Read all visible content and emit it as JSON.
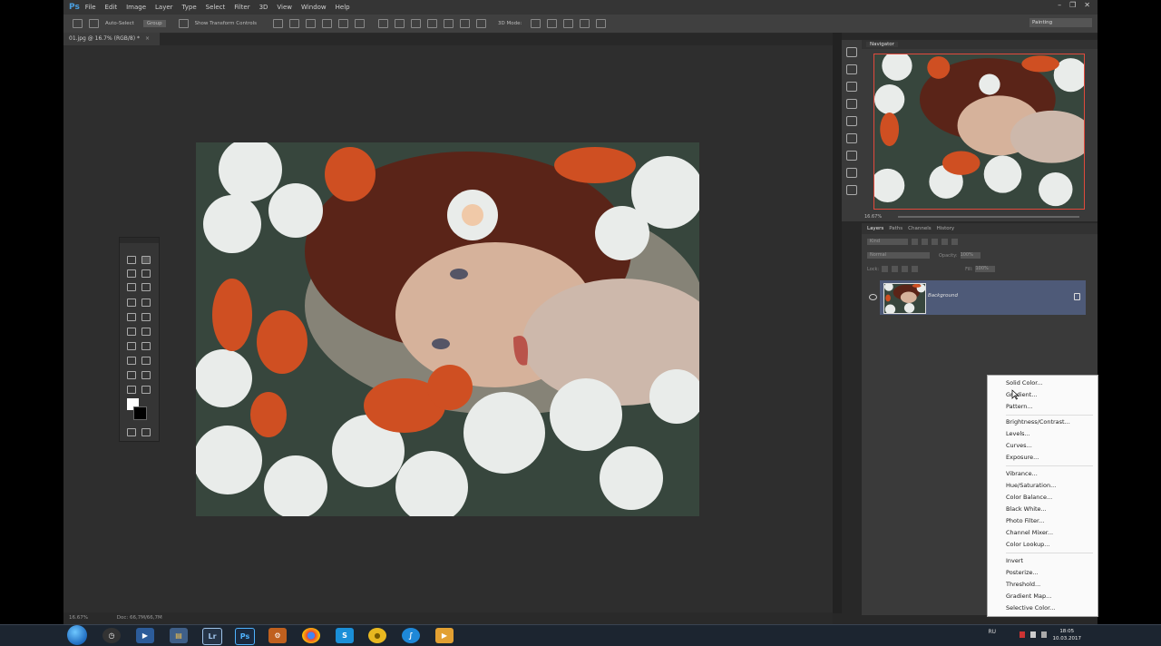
{
  "app": {
    "logo": "Ps",
    "window_controls": [
      "–",
      "❐",
      "✕"
    ]
  },
  "menubar": {
    "items": [
      "File",
      "Edit",
      "Image",
      "Layer",
      "Type",
      "Select",
      "Filter",
      "3D",
      "View",
      "Window",
      "Help"
    ]
  },
  "options": {
    "auto_select": "Auto-Select",
    "group": "Group",
    "show_transform": "Show Transform Controls",
    "mode_3d": "3D Mode:",
    "workspace": "Painting"
  },
  "document": {
    "tab_title": "01.jpg @ 16.7% (RGB/8) *",
    "close": "×"
  },
  "status": {
    "zoom": "16.67%",
    "doc_info": "Doc: 66,7M/66,7M"
  },
  "navigator": {
    "title": "Navigator",
    "zoom": "16.67%"
  },
  "layers_panel": {
    "tabs": [
      "Layers",
      "Paths",
      "Channels",
      "History"
    ],
    "kind": "Kind",
    "blend_mode": "Normal",
    "opacity_label": "Opacity:",
    "opacity_value": "100%",
    "lock_label": "Lock:",
    "fill_label": "Fill:",
    "fill_value": "100%",
    "layer_name": "Background"
  },
  "context_menu": {
    "group1": [
      "Solid Color...",
      "Gradient...",
      "Pattern..."
    ],
    "group2": [
      "Brightness/Contrast...",
      "Levels...",
      "Curves...",
      "Exposure..."
    ],
    "group3": [
      "Vibrance...",
      "Hue/Saturation...",
      "Color Balance...",
      "Black White...",
      "Photo Filter...",
      "Channel Mixer...",
      "Color Lookup..."
    ],
    "group4": [
      "Invert",
      "Posterize...",
      "Threshold...",
      "Gradient Map...",
      "Selective Color..."
    ]
  },
  "taskbar": {
    "apps": [
      "explorer-icon",
      "clock-icon",
      "media-icon",
      "folder-icon",
      "Lr",
      "Ps",
      "settings-icon",
      "chrome-icon",
      "S",
      "coin-icon",
      "skype-icon",
      "video-icon"
    ],
    "lang": "RU",
    "time": "18:05",
    "date": "10.03.2017"
  }
}
